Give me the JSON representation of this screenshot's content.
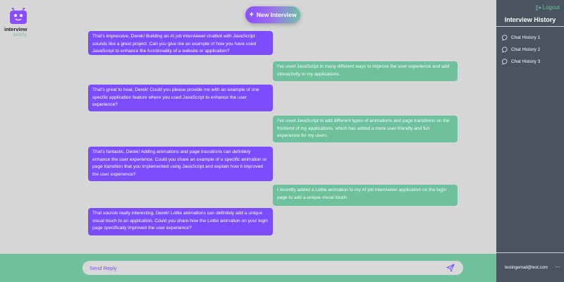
{
  "header": {
    "new_interview_label": "New Interview",
    "plus": "+"
  },
  "logo": {
    "line1": "interview",
    "line2": "buddy"
  },
  "messages": [
    {
      "role": "bot",
      "text": "That's impressive, Derek! Building an AI job interviewer chatbot with JavaScript sounds like a great project. Can you give me an example of how you have used JavaScript to enhance the functionality of a website or application?"
    },
    {
      "role": "user",
      "text": "I've used JavaScript in many different ways to improve the user experience and add interactivity to my applications."
    },
    {
      "role": "bot",
      "text": "That's great to hear, Derek! Could you please provide me with an example of one specific application feature where you used JavaScript to enhance the user experience?"
    },
    {
      "role": "user",
      "text": "I've used JavaScript to add different types of animations and page transitions on the frontend of my applications, which has added a more user-friendly and fun experience for my users."
    },
    {
      "role": "bot",
      "text": "That's fantastic, Derek! Adding animations and page transitions can definitely enhance the user experience. Could you share an example of a specific animation or page transition that you implemented using JavaScript and explain how it improved the user experience?"
    },
    {
      "role": "user",
      "text": "I recently added a Lottie animation to my AI job interviewer application on the login page to add a unique visual touch."
    },
    {
      "role": "bot",
      "text": "That sounds really interesting, Derek! Lottie animations can definitely add a unique visual touch to an application. Could you share how the Lottie animation on your login page specifically improved the user experience?"
    }
  ],
  "footer": {
    "reply_placeholder": "Send Reply"
  },
  "sidebar": {
    "logout_label": "Logout",
    "title": "Interview History",
    "history": [
      "Chat History 1",
      "Chat History 2",
      "Chat History 3"
    ],
    "email": "testingemail@test.com",
    "more": "···"
  },
  "colors": {
    "bot_bubble": "#7b4dff",
    "user_bubble": "#6fc19d",
    "sidebar": "#4a5360",
    "background": "#d6d6d6"
  }
}
